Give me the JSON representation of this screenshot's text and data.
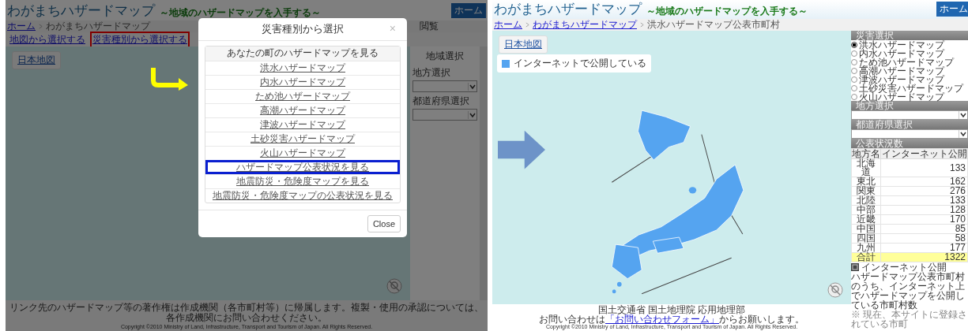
{
  "left_screen": {
    "header": {
      "title": "わがまちハザードマップ",
      "subtitle": "～地域のハザードマップを入手する～",
      "home_button": "ホーム"
    },
    "breadcrumb": [
      {
        "label": "ホーム",
        "link": true
      },
      {
        "label": "わがまちハザードマップ",
        "link": false
      }
    ],
    "partial_text": "閲覧",
    "nav_links": [
      {
        "label": "地図から選択する",
        "highlighted": false
      },
      {
        "label": "災害種別から選択する",
        "highlighted": true
      }
    ],
    "map_button": "日本地図",
    "sidebar": {
      "title": "地域選択",
      "fields": [
        {
          "label": "地方選択"
        },
        {
          "label": "都道府県選択"
        }
      ]
    },
    "footer": [
      "リンク先のハザードマップ等の著作権は作成機関（各市町村等）に帰属します。複製・使用の承認については、各作成機関にお問い合わせください。",
      "Copyright ©2010 Ministry of Land, Infrastructure, Transport and Tourism of Japan. All Rights Reserved."
    ],
    "modal": {
      "title": "災害種別から選択",
      "close": "×",
      "items": [
        {
          "label": "あなたの町のハザードマップを見る",
          "kind": "header",
          "highlighted": false
        },
        {
          "label": "洪水ハザードマップ",
          "kind": "link",
          "highlighted": false
        },
        {
          "label": "内水ハザードマップ",
          "kind": "link",
          "highlighted": false
        },
        {
          "label": "ため池ハザードマップ",
          "kind": "link",
          "highlighted": false
        },
        {
          "label": "高潮ハザードマップ",
          "kind": "link",
          "highlighted": false
        },
        {
          "label": "津波ハザードマップ",
          "kind": "link",
          "highlighted": false
        },
        {
          "label": "土砂災害ハザードマップ",
          "kind": "link",
          "highlighted": false
        },
        {
          "label": "火山ハザードマップ",
          "kind": "link",
          "highlighted": false
        },
        {
          "label": "ハザードマップ公表状況を見る",
          "kind": "link",
          "highlighted": true
        },
        {
          "label": "地震防災・危険度マップを見る",
          "kind": "link",
          "highlighted": false
        },
        {
          "label": "地震防災・危険度マップの公表状況を見る",
          "kind": "link",
          "highlighted": false
        }
      ],
      "button": "Close"
    }
  },
  "right_screen": {
    "header": {
      "title": "わがまちハザードマップ",
      "subtitle": "～地域のハザードマップを入手する～",
      "home_button": "ホーム"
    },
    "breadcrumb": [
      {
        "label": "ホーム",
        "link": true
      },
      {
        "label": "わがまちハザードマップ",
        "link": true
      },
      {
        "label": "洪水ハザードマップ公表市町村",
        "link": false
      }
    ],
    "map_button": "日本地図",
    "legend": {
      "label": "インターネットで公開している",
      "color": "#55a4f0"
    },
    "sidebar": {
      "hazard_title": "災害選択",
      "hazards": [
        {
          "label": "洪水ハザードマップ",
          "selected": true
        },
        {
          "label": "内水ハザードマップ",
          "selected": false
        },
        {
          "label": "ため池ハザードマップ",
          "selected": false
        },
        {
          "label": "高潮ハザードマップ",
          "selected": false
        },
        {
          "label": "津波ハザードマップ",
          "selected": false
        },
        {
          "label": "土砂災害ハザードマップ",
          "selected": false
        },
        {
          "label": "火山ハザードマップ",
          "selected": false
        }
      ],
      "region_title": "地方選択",
      "prefecture_title": "都道府県選択",
      "table_title": "公表状況数",
      "table": {
        "columns": [
          "地方名",
          "インターネット公開"
        ],
        "rows": [
          {
            "region": "北海道",
            "count": "133",
            "kind": "row"
          },
          {
            "region": "東北",
            "count": "162",
            "kind": "row"
          },
          {
            "region": "関東",
            "count": "276",
            "kind": "row"
          },
          {
            "region": "北陸",
            "count": "133",
            "kind": "row"
          },
          {
            "region": "中部",
            "count": "128",
            "kind": "row"
          },
          {
            "region": "近畿",
            "count": "170",
            "kind": "row"
          },
          {
            "region": "中国",
            "count": "85",
            "kind": "row"
          },
          {
            "region": "四国",
            "count": "58",
            "kind": "row"
          },
          {
            "region": "九州",
            "count": "177",
            "kind": "row"
          },
          {
            "region": "合計",
            "count": "1322",
            "kind": "total"
          }
        ]
      },
      "note_title": "インターネット公開",
      "note_text": "ハザードマップ公表市町村のうち、インターネット上でハザードマップを公開している市町村数",
      "note_cut": "※ 現在、本サイトに登録されている市町"
    },
    "footer": {
      "org": "国土交通省 国土地理院 応用地理部",
      "contact_prefix": "お問い合わせは",
      "contact_link": "「お問い合わせフォーム」",
      "contact_suffix": "からお願いします。",
      "copyright": "Copyright ©2010 Ministry of Land, Infrastructure, Transport and Tourism of Japan. All Rights Reserved."
    }
  }
}
